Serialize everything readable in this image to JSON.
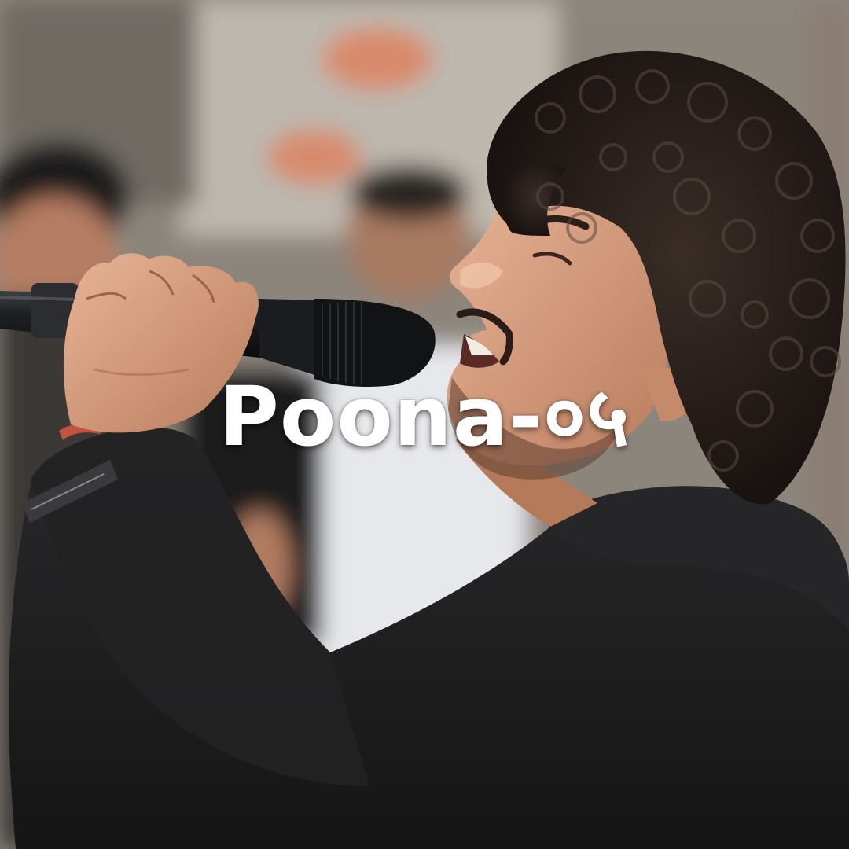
{
  "title_overlay": "Poona-०५"
}
